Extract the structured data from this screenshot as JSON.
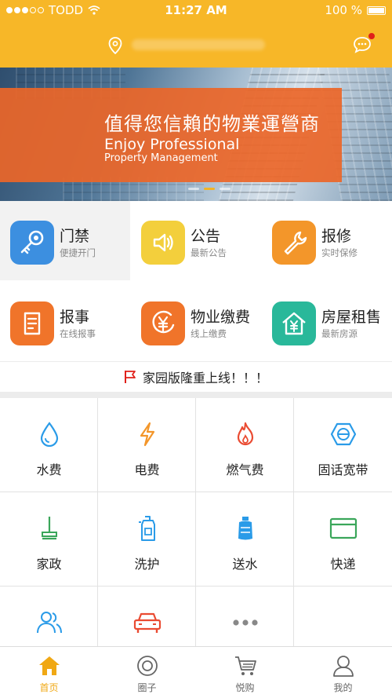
{
  "status_bar": {
    "carrier": "TODD",
    "time": "11:27 AM",
    "battery": "100 %"
  },
  "banner": {
    "title_cn": "值得您信賴的物業運營商",
    "title_en": "Enjoy Professional",
    "subtitle_en": "Property Management"
  },
  "main_features": [
    {
      "title": "门禁",
      "sub": "便捷开门",
      "color": "#3c8fe0",
      "icon": "key-icon"
    },
    {
      "title": "公告",
      "sub": "最新公告",
      "color": "#f3cf3c",
      "icon": "speaker-icon"
    },
    {
      "title": "报修",
      "sub": "实时保修",
      "color": "#f3962a",
      "icon": "wrench-icon"
    },
    {
      "title": "报事",
      "sub": "在线报事",
      "color": "#f0742a",
      "icon": "document-icon"
    },
    {
      "title": "物业缴费",
      "sub": "线上缴费",
      "color": "#f0742a",
      "icon": "yen-coin-icon"
    },
    {
      "title": "房屋租售",
      "sub": "最新房源",
      "color": "#29b89a",
      "icon": "house-yen-icon"
    }
  ],
  "notice": {
    "text": "家园版隆重上线！！！",
    "icon": "flag-icon",
    "color": "#e0201a"
  },
  "services": [
    {
      "label": "水费",
      "icon": "water-drop-icon"
    },
    {
      "label": "电费",
      "icon": "lightning-icon"
    },
    {
      "label": "燃气费",
      "icon": "flame-icon"
    },
    {
      "label": "固话宽带",
      "icon": "broadband-icon"
    },
    {
      "label": "家政",
      "icon": "mop-icon"
    },
    {
      "label": "洗护",
      "icon": "bottle-icon"
    },
    {
      "label": "送水",
      "icon": "water-jug-icon"
    },
    {
      "label": "快递",
      "icon": "card-icon"
    },
    {
      "label": "",
      "icon": "people-icon"
    },
    {
      "label": "",
      "icon": "car-icon"
    },
    {
      "label": "",
      "icon": "more-dots-icon"
    }
  ],
  "tabs": [
    {
      "label": "首页",
      "icon": "home-icon",
      "active": true
    },
    {
      "label": "圈子",
      "icon": "circle-icon"
    },
    {
      "label": "悦购",
      "icon": "cart-icon"
    },
    {
      "label": "我的",
      "icon": "user-icon"
    }
  ],
  "colors": {
    "header": "#f7b728",
    "accent": "#f0a814",
    "banner_band": "#eb6628"
  }
}
